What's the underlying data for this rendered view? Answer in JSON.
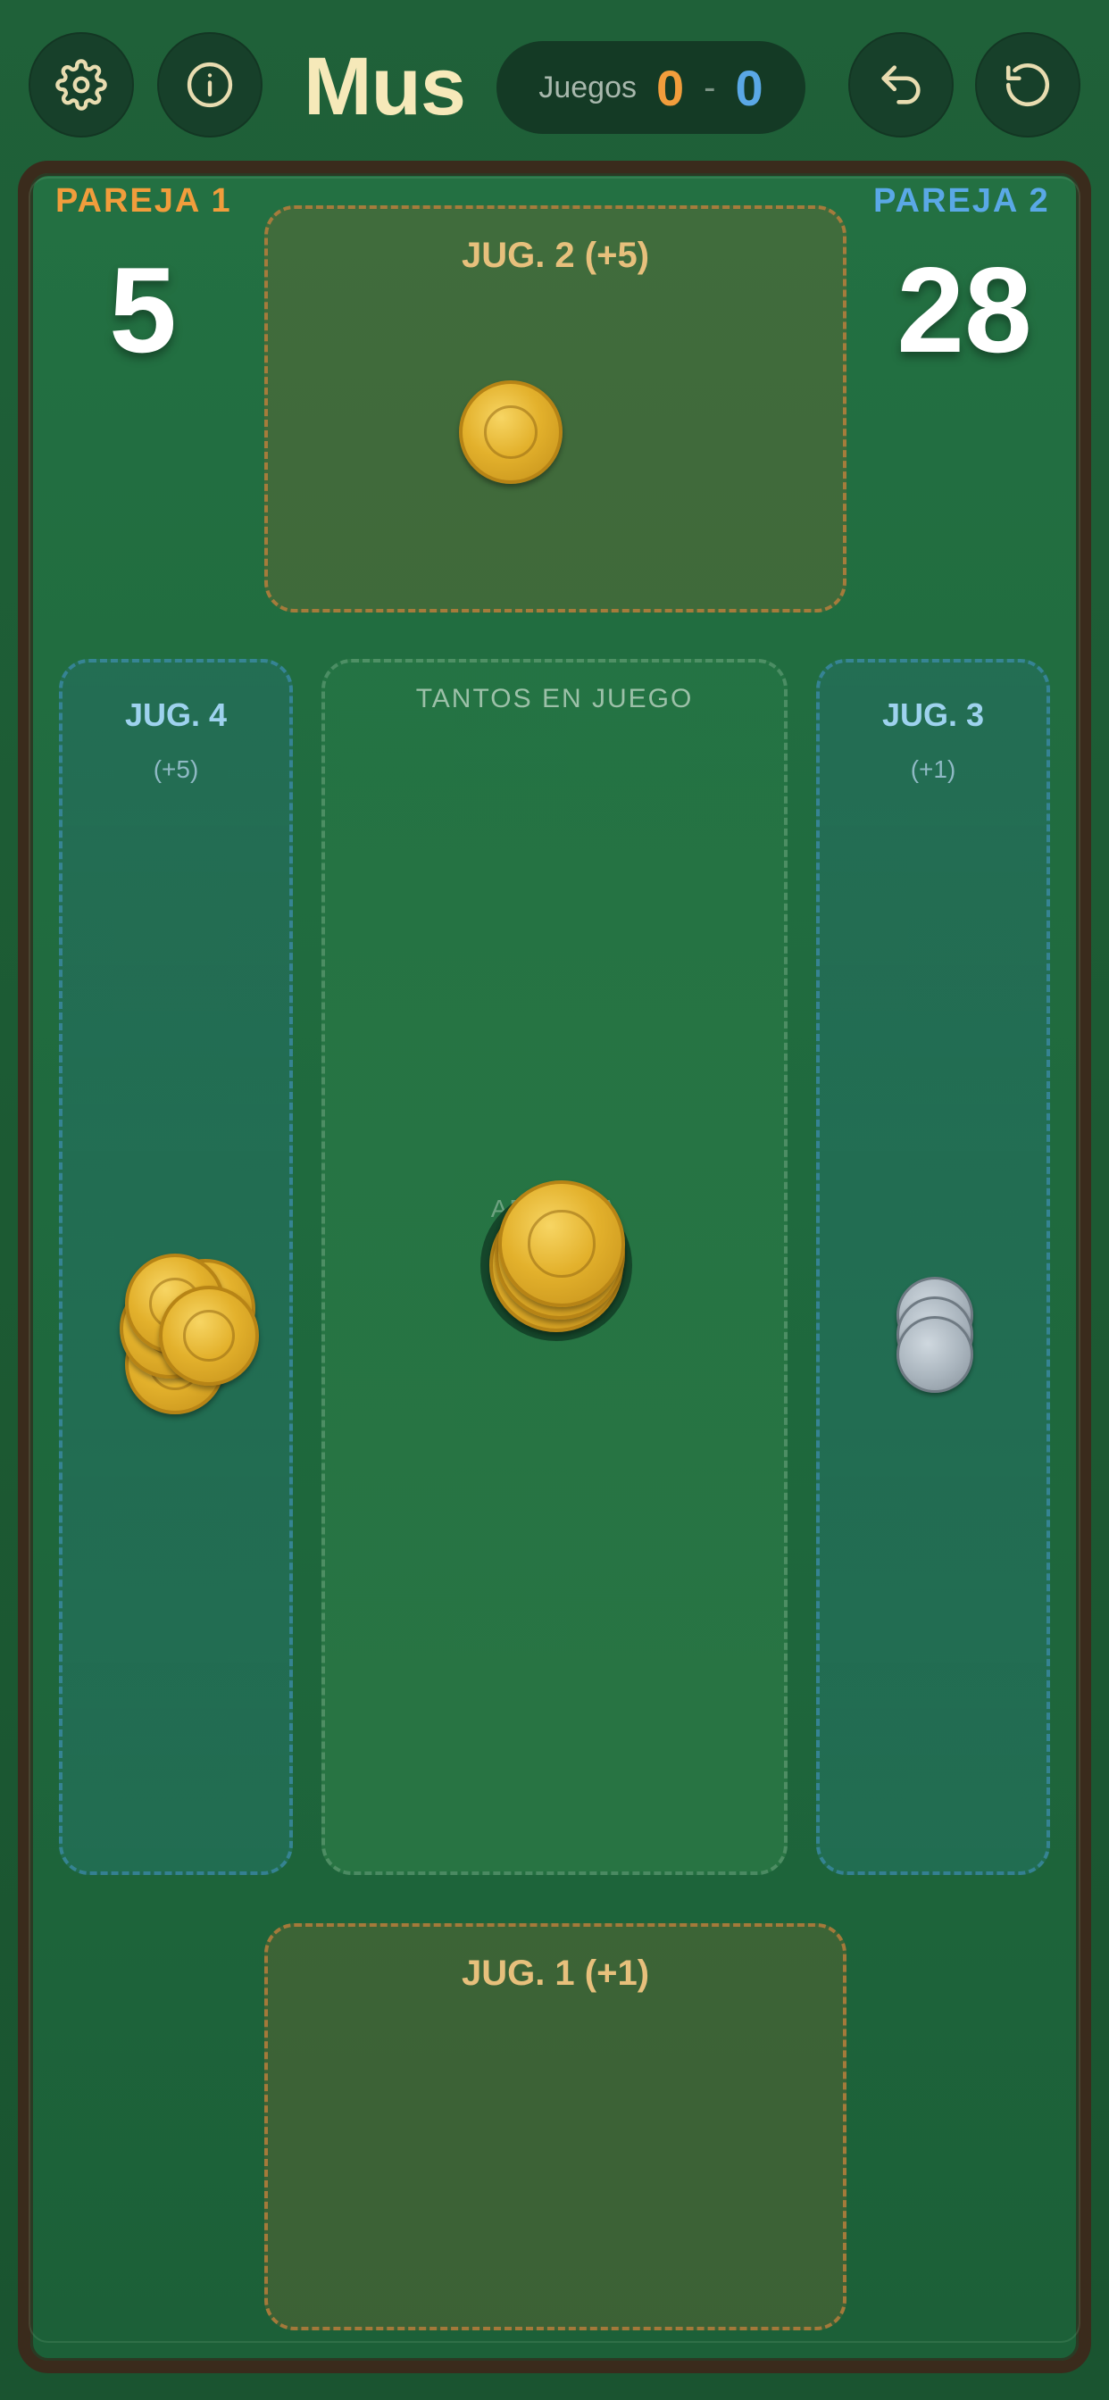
{
  "header": {
    "title": "Mus",
    "games_label": "Juegos",
    "games_team1": "0",
    "games_separator": "-",
    "games_team2": "0"
  },
  "teams": [
    {
      "label": "PAREJA 1",
      "score": "5",
      "color": "#f19d3c"
    },
    {
      "label": "PAREJA 2",
      "score": "28",
      "color": "#5aa8e6"
    }
  ],
  "players": {
    "top": {
      "label": "JUG. 2 (+5)"
    },
    "left": {
      "label": "JUG. 4",
      "sub": "(+5)"
    },
    "right": {
      "label": "JUG. 3",
      "sub": "(+1)"
    },
    "bottom": {
      "label": "JUG. 1 (+1)"
    }
  },
  "center": {
    "label": "TANTOS EN JUEGO",
    "faint_label": "APUESTA"
  },
  "colors": {
    "felt": "#1f6a3e",
    "rail": "#3a2b1c",
    "title": "#f6e9b9",
    "gold_chip": "#e3b12c",
    "silver_chip": "#a9b4bd"
  },
  "icons": {
    "settings": "gear-icon",
    "info": "info-icon",
    "undo": "undo-arrow-icon",
    "reset": "reset-icon"
  }
}
